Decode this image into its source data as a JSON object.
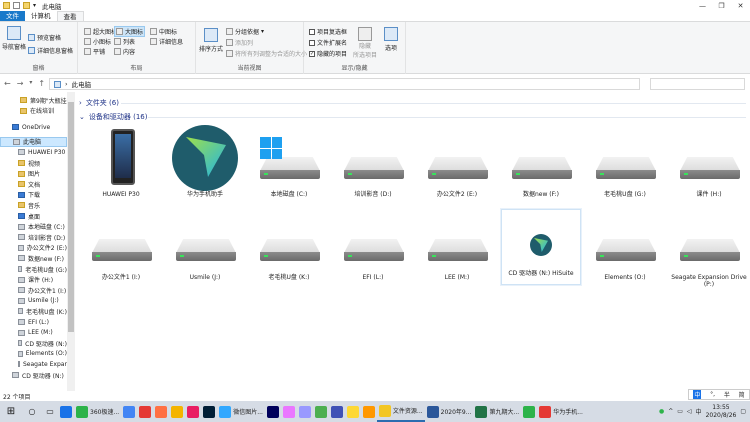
{
  "window": {
    "title": "此电脑",
    "controls": [
      "—",
      "❐",
      "✕"
    ]
  },
  "ribbon_tabs": [
    "文件",
    "计算机",
    "查看"
  ],
  "ribbon": {
    "pane": {
      "nav_pane": "导航窗格",
      "preview": "预览窗格",
      "details": "详细信息窗格",
      "group": "窗格"
    },
    "layout": {
      "extra_large": "超大图标",
      "large": "大图标",
      "medium": "中图标",
      "small": "小图标",
      "list": "列表",
      "details": "详细信息",
      "tiles": "平铺",
      "content": "内容",
      "group": "布局"
    },
    "current_view": {
      "sort": "排序方式",
      "group_by": "分组依据",
      "add_columns": "添加列",
      "size_all": "将所有列调整为合适的大小",
      "group": "当前视图"
    },
    "show_hide": {
      "item_checkboxes": "项目复选框",
      "file_ext": "文件扩展名",
      "hidden_items": "隐藏的项目",
      "hide": "隐藏",
      "selected_items": "所选项目",
      "options": "选项",
      "group": "显示/隐藏"
    }
  },
  "address": {
    "path": "此电脑"
  },
  "sidebar": [
    {
      "label": "第9期\"大瓶挂",
      "indent": 20,
      "icon": "folder"
    },
    {
      "label": "在线培训",
      "indent": 20,
      "icon": "folder"
    },
    {
      "label": "OneDrive",
      "indent": 12,
      "icon": "cloud"
    },
    {
      "label": "此电脑",
      "indent": 12,
      "icon": "pc",
      "selected": true
    },
    {
      "label": "HUAWEI P30",
      "indent": 18,
      "icon": "phone"
    },
    {
      "label": "视频",
      "indent": 18,
      "icon": "video"
    },
    {
      "label": "图片",
      "indent": 18,
      "icon": "image"
    },
    {
      "label": "文档",
      "indent": 18,
      "icon": "doc"
    },
    {
      "label": "下载",
      "indent": 18,
      "icon": "download"
    },
    {
      "label": "音乐",
      "indent": 18,
      "icon": "music"
    },
    {
      "label": "桌面",
      "indent": 18,
      "icon": "desktop"
    },
    {
      "label": "本地磁盘 (C:)",
      "indent": 18,
      "icon": "drive"
    },
    {
      "label": "培训影音 (D:)",
      "indent": 18,
      "icon": "drive"
    },
    {
      "label": "办公文件2 (E:)",
      "indent": 18,
      "icon": "drive"
    },
    {
      "label": "数据new (F:)",
      "indent": 18,
      "icon": "drive"
    },
    {
      "label": "老毛桃U盘 (G:)",
      "indent": 18,
      "icon": "drive"
    },
    {
      "label": "课件 (H:)",
      "indent": 18,
      "icon": "drive"
    },
    {
      "label": "办公文件1 (I:)",
      "indent": 18,
      "icon": "drive"
    },
    {
      "label": "Usmile (J:)",
      "indent": 18,
      "icon": "drive"
    },
    {
      "label": "老毛桃U盘 (K:)",
      "indent": 18,
      "icon": "drive"
    },
    {
      "label": "EFI (L:)",
      "indent": 18,
      "icon": "drive"
    },
    {
      "label": "LEE (M:)",
      "indent": 18,
      "icon": "drive"
    },
    {
      "label": "CD 驱动器 (N:)",
      "indent": 18,
      "icon": "cd"
    },
    {
      "label": "Elements (O:)",
      "indent": 18,
      "icon": "drive"
    },
    {
      "label": "Seagate Expan",
      "indent": 18,
      "icon": "drive"
    },
    {
      "label": "CD 驱动器 (N:)",
      "indent": 12,
      "icon": "cd"
    }
  ],
  "sections": {
    "folders": "文件夹 (6)",
    "devices": "设备和驱动器 (16)"
  },
  "devices": [
    {
      "label": "HUAWEI P30",
      "kind": "phone"
    },
    {
      "label": "华为手机助手",
      "kind": "app"
    },
    {
      "label": "本地磁盘 (C:)",
      "kind": "windrive"
    },
    {
      "label": "培训影音 (D:)",
      "kind": "drive"
    },
    {
      "label": "办公文件2 (E:)",
      "kind": "drive"
    },
    {
      "label": "数据new (F:)",
      "kind": "drive"
    },
    {
      "label": "老毛桃U盘 (G:)",
      "kind": "drive"
    },
    {
      "label": "课件 (H:)",
      "kind": "drive"
    },
    {
      "label": "办公文件1 (I:)",
      "kind": "drive"
    },
    {
      "label": "Usmile (J:)",
      "kind": "drive"
    },
    {
      "label": "老毛桃U盘 (K:)",
      "kind": "drive"
    },
    {
      "label": "EFI (L:)",
      "kind": "drive"
    },
    {
      "label": "LEE (M:)",
      "kind": "drive"
    },
    {
      "label": "CD 驱动器 (N:) HiSuite",
      "kind": "cd"
    },
    {
      "label": "Elements (O:)",
      "kind": "drive"
    },
    {
      "label": "Seagate Expansion Drive (P:)",
      "kind": "drive"
    }
  ],
  "status": "22 个项目",
  "ime": {
    "lang": "中",
    "punct": "°,",
    "mode": "半",
    "extra": "简"
  },
  "taskbar": {
    "apps": [
      {
        "label": "",
        "color": "#1a73e8"
      },
      {
        "label": "360极速...",
        "color": "#2db34a"
      },
      {
        "label": "",
        "color": "#4285f4"
      },
      {
        "label": "",
        "color": "#e53935"
      },
      {
        "label": "",
        "color": "#ff7043"
      },
      {
        "label": "",
        "color": "#f4b400"
      },
      {
        "label": "",
        "color": "#e91e63"
      },
      {
        "label": "",
        "color": "#001e36"
      },
      {
        "label": "微信图片...",
        "color": "#31a8ff"
      },
      {
        "label": "",
        "color": "#00005b"
      },
      {
        "label": "",
        "color": "#ea77ff"
      },
      {
        "label": "",
        "color": "#9999ff"
      },
      {
        "label": "",
        "color": "#4caf50"
      },
      {
        "label": "",
        "color": "#3f51b5"
      },
      {
        "label": "",
        "color": "#fdd835"
      },
      {
        "label": "",
        "color": "#ff9800"
      },
      {
        "label": "文件资源...",
        "color": "#f3c623",
        "active": true
      },
      {
        "label": "2020年9...",
        "color": "#2b579a"
      },
      {
        "label": "第九期大...",
        "color": "#217346"
      },
      {
        "label": "",
        "color": "#2db34a"
      },
      {
        "label": "华为手机...",
        "color": "#e53935"
      }
    ],
    "time": "13:55",
    "date": "2020/8/26"
  }
}
